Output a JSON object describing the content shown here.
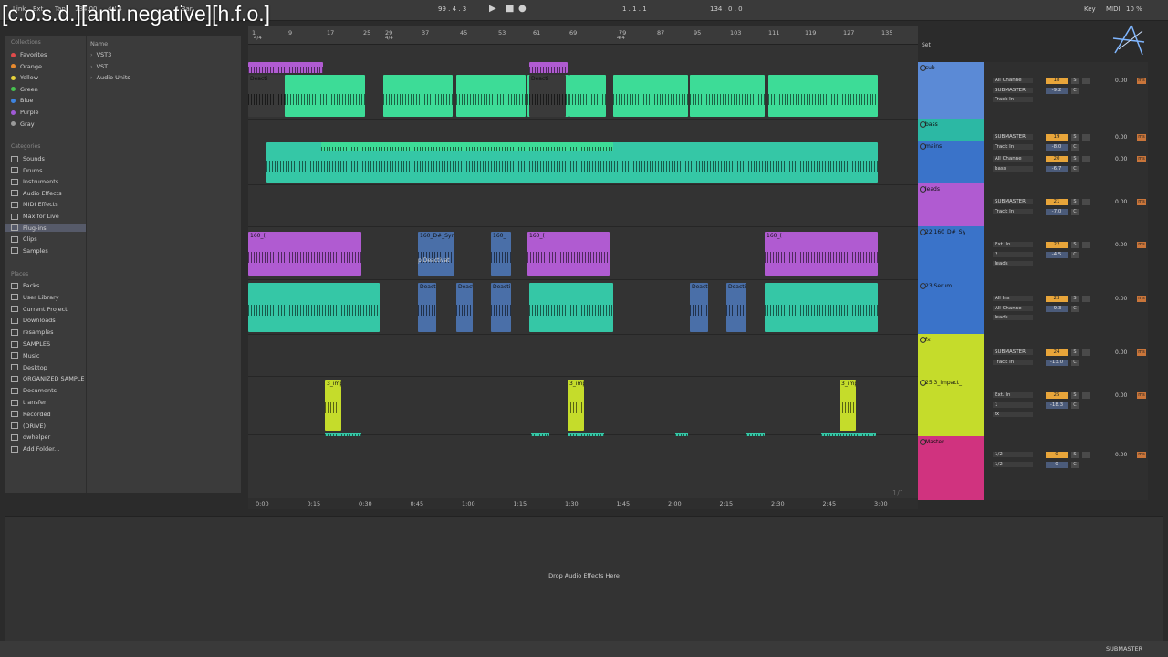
{
  "watermark": "[c.o.s.d.][anti.negative][h.f.o.]",
  "top_bar": {
    "link": "Link",
    "ext": "Ext",
    "tap": "Tap",
    "tempo": "134.00",
    "sig": "4 / 4",
    "bar": "1 Bar",
    "pos1": "99 . 4 . 3",
    "pos2": "1 . 1 . 1",
    "len": "134 . 0 . 0",
    "key": "Key",
    "midi": "MIDI",
    "cpu": "10 %"
  },
  "browser": {
    "collections_title": "Collections",
    "collections": [
      {
        "label": "Favorites",
        "color": "#e04b4b"
      },
      {
        "label": "Orange",
        "color": "#e88a2e"
      },
      {
        "label": "Yellow",
        "color": "#e7d23b"
      },
      {
        "label": "Green",
        "color": "#47c24f"
      },
      {
        "label": "Blue",
        "color": "#3e84e0"
      },
      {
        "label": "Purple",
        "color": "#a05ad6"
      },
      {
        "label": "Gray",
        "color": "#9a9a9a"
      }
    ],
    "categories_title": "Categories",
    "categories": [
      "Sounds",
      "Drums",
      "Instruments",
      "Audio Effects",
      "MIDI Effects",
      "Max for Live",
      "Plug-ins",
      "Clips",
      "Samples"
    ],
    "places_title": "Places",
    "places": [
      "Packs",
      "User Library",
      "Current Project",
      "Downloads",
      "resamples",
      "SAMPLES",
      "Music",
      "Desktop",
      "ORGANIZED SAMPLE",
      "Documents",
      "transfer",
      "Recorded",
      "(DRIVE)",
      "dwhelper",
      "Add Folder..."
    ],
    "name_header": "Name",
    "plugin_items": [
      "VST3",
      "VST",
      "Audio Units"
    ]
  },
  "ruler": {
    "bars": [
      "1",
      "9",
      "17",
      "25",
      "29",
      "37",
      "45",
      "53",
      "61",
      "69",
      "79",
      "87",
      "95",
      "103",
      "111",
      "119",
      "127",
      "135"
    ],
    "sig_a": "4/4",
    "sig_b": "4/4",
    "sig_c": "4/4"
  },
  "timebar": {
    "times": [
      "0:00",
      "0:15",
      "0:30",
      "0:45",
      "1:00",
      "1:15",
      "1:30",
      "1:45",
      "2:00",
      "2:15",
      "2:30",
      "2:45",
      "3:00"
    ],
    "page": "1/1"
  },
  "clip_labels": {
    "deact": "Deacti",
    "syn": "160_D#_Syn",
    "p_deact": "p Deactivat",
    "s160": "160_(",
    "s160b": "160_",
    "impact": "3_imp"
  },
  "tracks": [
    {
      "name": "sub",
      "io1": "All Channe",
      "io2": "SUBMASTER",
      "io3": "Track In",
      "num": "18",
      "vol": "-9.2",
      "pan": "0.00",
      "color": "#5b8ad6"
    },
    {
      "name": "bass",
      "io1": "SUBMASTER",
      "io2": "Track In",
      "num": "19",
      "vol": "-8.0",
      "pan": "0.00",
      "color": "#2cb8a4"
    },
    {
      "name": "mains",
      "io1": "All Channe",
      "io2": "bass",
      "num": "20",
      "vol": "-6.7",
      "pan": "0.00",
      "color": "#3a73c9"
    },
    {
      "name": "leads",
      "io1": "SUBMASTER",
      "io2": "Track In",
      "num": "21",
      "vol": "-7.0",
      "pan": "0.00",
      "color": "#b05bd1"
    },
    {
      "name": "22 160_D#_Sy",
      "io1": "Ext. In",
      "io2": "2",
      "io3": "leads",
      "num": "22",
      "vol": "-4.5",
      "pan": "0.00",
      "color": "#3a73c9"
    },
    {
      "name": "23 Serum",
      "io1": "All Ins",
      "io2": "All Channe",
      "io3": "leads",
      "num": "23",
      "vol": "-9.3",
      "pan": "0.00",
      "color": "#3a73c9"
    },
    {
      "name": "fx",
      "io1": "SUBMASTER",
      "io2": "Track In",
      "num": "24",
      "vol": "-13.0",
      "pan": "0.00",
      "color": "#c5dc2b"
    },
    {
      "name": "25 3_impact_",
      "io1": "Ext. In",
      "io2": "1",
      "io3": "fx",
      "num": "25",
      "vol": "-18.3",
      "pan": "0.00",
      "color": "#c5dc2b"
    },
    {
      "name": "Master",
      "io1": "1/2",
      "io2": "1/2",
      "num": "0",
      "vol": "0",
      "pan": "0.00",
      "color": "#d0337f"
    }
  ],
  "mix_labels": {
    "auto": "Auto",
    "off": "Off",
    "in": "In",
    "s": "S",
    "c": "C",
    "ms": "ms"
  },
  "set_label": "Set",
  "detail_drop": "Drop Audio Effects Here",
  "status_right": "SUBMASTER",
  "colors": {
    "green": "#3ddc97",
    "teal": "#35c7a6",
    "purple": "#b05bd1",
    "blue": "#4a6fa8",
    "yellow": "#c5dc2b",
    "pink": "#d0337f"
  }
}
